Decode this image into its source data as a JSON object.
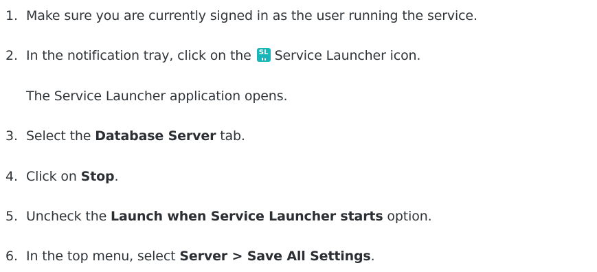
{
  "steps": [
    {
      "number": "1.",
      "text": "Make sure you are currently signed in as the user running the service."
    },
    {
      "number": "2.",
      "before": "In the notification tray, click on the",
      "icon": {
        "name": "service-launcher-icon",
        "label": "SL",
        "color": "#19b5b8"
      },
      "after": "Service Launcher icon.",
      "note": "The Service Launcher application opens."
    },
    {
      "number": "3.",
      "before": "Select the",
      "bold": "Database Server",
      "after": "tab."
    },
    {
      "number": "4.",
      "before": "Click on",
      "bold": "Stop",
      "after": "."
    },
    {
      "number": "5.",
      "before": "Uncheck the",
      "bold": "Launch when Service Launcher starts",
      "after": "option."
    },
    {
      "number": "6.",
      "before": "In the top menu, select",
      "bold": "Server > Save All Settings",
      "after": "."
    }
  ]
}
